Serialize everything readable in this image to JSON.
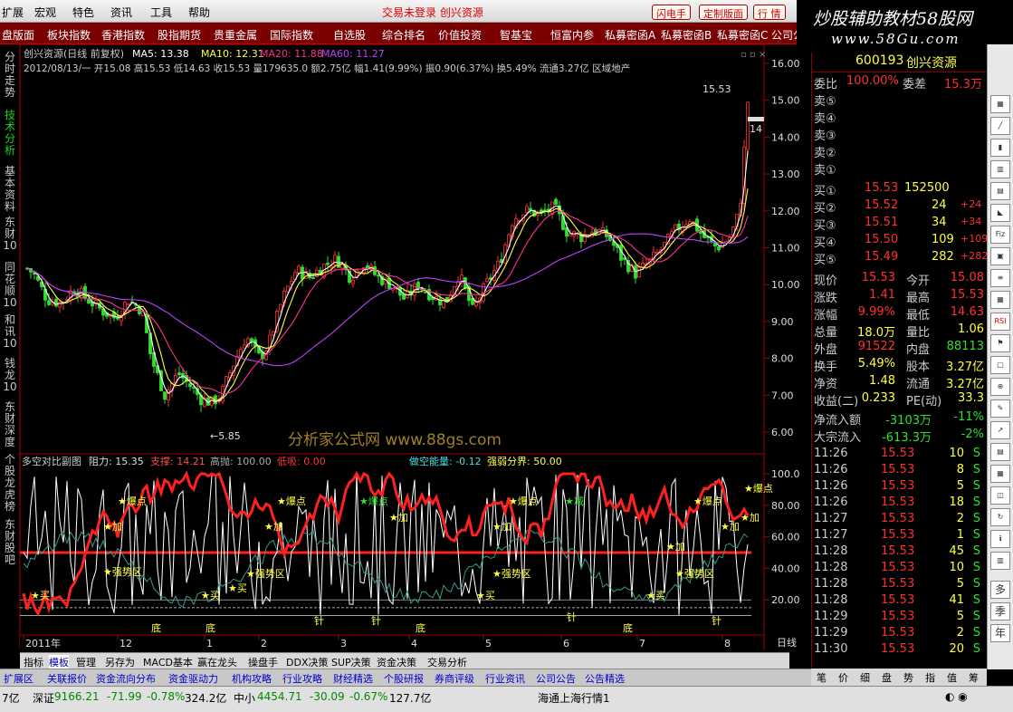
{
  "menubar": {
    "items": [
      "扩展",
      "宏观",
      "特色",
      "资讯",
      "工具",
      "帮助"
    ],
    "status_text": "交易未登录 创兴资源",
    "buttons": [
      "闪电手",
      "定制版面",
      "行 情"
    ]
  },
  "brand": {
    "title": "炒股辅助教材58股网",
    "url": "www.58Gu.com"
  },
  "navbar": {
    "items": [
      "盘版面",
      "板块指数",
      "香港指数",
      "股指期货",
      "贵重金属",
      "国际指数",
      "自选股",
      "综合排名",
      "价值投资",
      "智基宝",
      "恒富内参",
      "私募密函A",
      "私募密函B",
      "私募密函C",
      "公司公"
    ]
  },
  "left_tabs": [
    "分时走势",
    "技术分析",
    "基本资料",
    "东财10",
    "同花顺10",
    "和讯10",
    "钱龙10",
    "东财深度",
    "个股龙虎榜",
    "东财股吧"
  ],
  "main_chart": {
    "title_line1": "创兴资源(日线 前复权)",
    "ma5": "MA5: 13.38",
    "ma10": "MA10: 12.31",
    "ma20": "MA20: 11.88",
    "ma60": "MA60: 11.27",
    "title_line2": "2012/08/13/一 开15.08 高15.53 低14.63 收15.53 量179635.0 额2.75亿 幅1.41(9.99%) 振0.90(6.37%) 换5.49% 流通3.27亿 区域地产",
    "high_label": "15.53",
    "low_label": "←5.85",
    "price_tag": "14",
    "watermark": "分析家公式网 www.88gs.com",
    "y_ticks": [
      "16.00",
      "15.00",
      "14.00",
      "13.00",
      "12.00",
      "11.00",
      "10.00",
      "9.00",
      "8.00",
      "7.00",
      "6.00"
    ]
  },
  "sub_chart": {
    "title": "多空对比副图",
    "resist": "阻力: 15.35",
    "support": "支撑: 14.21",
    "high_throw": "高抛: 100.00",
    "low_suck": "低吸: 0.00",
    "energy": "做空能量: -0.12",
    "strong_weak": "强弱分界: 50.00",
    "y_ticks": [
      "100.0",
      "80.00",
      "60.00",
      "40.00",
      "20.00"
    ],
    "annotations": [
      "买",
      "加",
      "爆点",
      "强势区",
      "底",
      "针",
      "减"
    ]
  },
  "x_axis": {
    "labels": [
      "2011年",
      "12",
      "1",
      "2",
      "3",
      "4",
      "5",
      "6",
      "7",
      "8"
    ],
    "period": "日线"
  },
  "bottom_tabs": [
    "指标",
    "模板",
    "管理",
    "另存为",
    "MACD基本",
    "赢在龙头",
    "操盘手",
    "DDX决策",
    "SUP决策",
    "资金决策",
    "交易分析"
  ],
  "bottom_tabs2": [
    "扩展区",
    "关联报价",
    "资金流向分布",
    "资金驱动力",
    "机构攻略",
    "行业攻略",
    "财经精选",
    "个股研报",
    "券商评级",
    "行业资讯",
    "公司公告",
    "公告精选"
  ],
  "quote": {
    "code": "600193",
    "name": "创兴资源",
    "weibi_label": "委比",
    "weibi": "100.00%",
    "weicha_label": "委差",
    "weicha": "15.3万",
    "sells": [
      {
        "label": "卖⑤"
      },
      {
        "label": "卖④"
      },
      {
        "label": "卖③"
      },
      {
        "label": "卖②"
      },
      {
        "label": "卖①"
      }
    ],
    "buys": [
      {
        "label": "买①",
        "price": "15.53",
        "vol": "152500",
        "chg": ""
      },
      {
        "label": "买②",
        "price": "15.52",
        "vol": "24",
        "chg": "+24"
      },
      {
        "label": "买③",
        "price": "15.51",
        "vol": "34",
        "chg": "+34"
      },
      {
        "label": "买④",
        "price": "15.50",
        "vol": "109",
        "chg": "+109"
      },
      {
        "label": "买⑤",
        "price": "15.49",
        "vol": "282",
        "chg": "+282"
      }
    ],
    "stats": [
      [
        "现价",
        "15.53",
        "今开",
        "15.08"
      ],
      [
        "涨跌",
        "1.41",
        "最高",
        "15.53"
      ],
      [
        "涨幅",
        "9.99%",
        "最低",
        "14.63"
      ],
      [
        "总量",
        "18.0万",
        "量比",
        "1.06"
      ],
      [
        "外盘",
        "91522",
        "内盘",
        "88113"
      ],
      [
        "换手",
        "5.49%",
        "股本",
        "3.27亿"
      ],
      [
        "净资",
        "1.48",
        "流通",
        "3.27亿"
      ],
      [
        "收益(二)",
        "0.233",
        "PE(动)",
        "33.3"
      ]
    ],
    "flows": [
      [
        "净流入额",
        "-3103万",
        "-11%"
      ],
      [
        "大宗流入",
        "-613.3万",
        "-2%"
      ]
    ],
    "ticks": [
      [
        "11:26",
        "15.53",
        "10",
        "S"
      ],
      [
        "11:26",
        "15.53",
        "8",
        "S"
      ],
      [
        "11:26",
        "15.53",
        "5",
        "S"
      ],
      [
        "11:26",
        "15.53",
        "18",
        "S"
      ],
      [
        "11:27",
        "15.53",
        "2",
        "S"
      ],
      [
        "11:27",
        "15.53",
        "1",
        "S"
      ],
      [
        "11:28",
        "15.53",
        "45",
        "S"
      ],
      [
        "11:28",
        "15.53",
        "10",
        "S"
      ],
      [
        "11:28",
        "15.53",
        "5",
        "S"
      ],
      [
        "11:28",
        "15.53",
        "41",
        "S"
      ],
      [
        "11:29",
        "15.53",
        "5",
        "S"
      ],
      [
        "11:29",
        "15.53",
        "2",
        "S"
      ],
      [
        "11:30",
        "15.53",
        "20",
        "S"
      ]
    ]
  },
  "right_tabs": [
    "笔",
    "价",
    "细",
    "盘",
    "势",
    "指",
    "值",
    "筹"
  ],
  "right_side_labels": [
    "Fiz",
    "RSI",
    "多",
    "季",
    "年"
  ],
  "statusbar": {
    "item0": "7亿",
    "sz_label": "深证",
    "sz_val": "9166.21",
    "sz_chg": "-71.99",
    "sz_pct": "-0.78%",
    "sz_amt": "324.2亿",
    "zx_label": "中小",
    "zx_val": "4454.71",
    "zx_chg": "-30.09",
    "zx_pct": "-0.67%",
    "zx_amt": "127.7亿",
    "market": "海通上海行情1"
  },
  "colors": {
    "up": "#ff3030",
    "down": "#30e030",
    "bg": "#000000",
    "accent": "#c40000"
  }
}
